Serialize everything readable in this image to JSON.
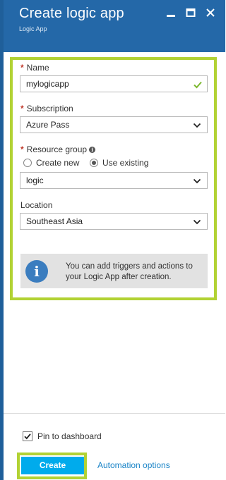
{
  "header": {
    "title": "Create logic app",
    "subtitle": "Logic App"
  },
  "form": {
    "name": {
      "label": "Name",
      "value": "mylogicapp"
    },
    "subscription": {
      "label": "Subscription",
      "value": "Azure Pass"
    },
    "resource_group": {
      "label": "Resource group",
      "options": [
        "Create new",
        "Use existing"
      ],
      "selected": "Use existing",
      "value": "logic"
    },
    "location": {
      "label": "Location",
      "value": "Southeast Asia"
    },
    "info_text": "You can add triggers and actions to your Logic App after creation."
  },
  "footer": {
    "pin_label": "Pin to dashboard",
    "pin_checked": true,
    "create_label": "Create",
    "automation_label": "Automation options"
  },
  "colors": {
    "header_bg": "#2468a8",
    "highlight": "#b2d234",
    "create_button": "#00abec",
    "link": "#1a84c7"
  }
}
